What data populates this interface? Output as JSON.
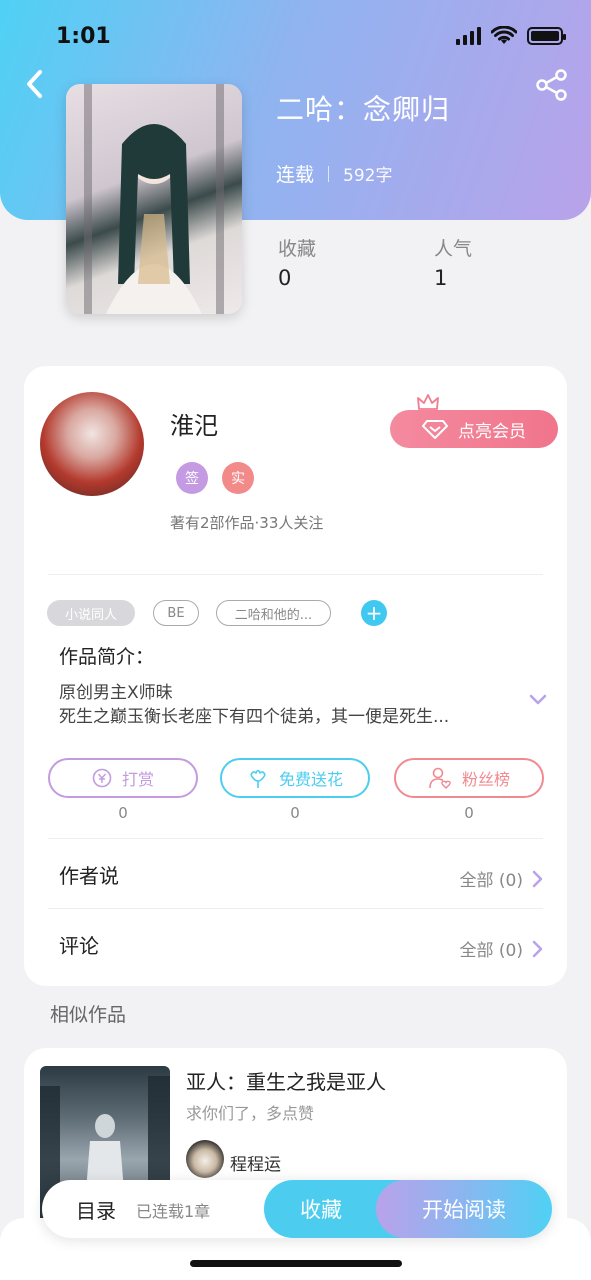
{
  "status_bar": {
    "time": "1:01"
  },
  "book": {
    "title": "二哈：念卿归",
    "status": "连载",
    "word_count": "592字",
    "stats": [
      {
        "label": "收藏",
        "value": "0"
      },
      {
        "label": "人气",
        "value": "1"
      }
    ]
  },
  "author": {
    "name": "淮汜",
    "badges": [
      "签",
      "实"
    ],
    "summary": "著有2部作品·33人关注",
    "vip_button": "点亮会员"
  },
  "tags": [
    "小说同人",
    "BE",
    "二哈和他的..."
  ],
  "intro": {
    "label": "作品简介：",
    "lines": [
      "原创男主X师昧",
      "死生之巅玉衡长老座下有四个徒弟，其一便是死生..."
    ]
  },
  "actions": [
    {
      "label": "打赏",
      "count": "0",
      "color": "#c29be0"
    },
    {
      "label": "免费送花",
      "count": "0",
      "color": "#4ccdf0"
    },
    {
      "label": "粉丝榜",
      "count": "0",
      "color": "#f08a90"
    }
  ],
  "rows": [
    {
      "label": "作者说",
      "right": "全部 (0)"
    },
    {
      "label": "评论",
      "right": "全部 (0)"
    }
  ],
  "similar": {
    "section_title": "相似作品",
    "items": [
      {
        "title": "亚人：重生之我是亚人",
        "subtitle": "求你们了，多点赞",
        "author": "程程运"
      }
    ]
  },
  "bottom_bar": {
    "toc_label": "目录",
    "toc_status": "已连载1章",
    "collect_label": "收藏",
    "read_label": "开始阅读"
  },
  "colors": {
    "accent_cyan": "#4ccdf0",
    "accent_purple": "#b9a2ea",
    "vip_pink": "#f0758c"
  }
}
